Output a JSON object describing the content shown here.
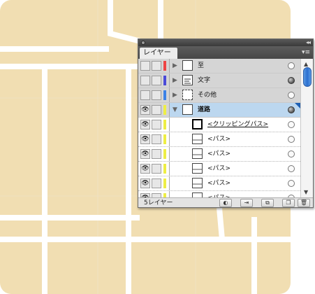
{
  "map": {
    "background_color": "#ffffff",
    "block_color": "#f1deb2",
    "road_color": "#ffffff",
    "tile_line_color": "#ece4d2"
  },
  "panel": {
    "collapse_icon": "double-chevron-left-icon",
    "tab_label": "レイヤー",
    "menu_icon": "panel-menu-icon",
    "layers": [
      {
        "name": "至",
        "kind": "main",
        "expanded": false,
        "color": "#ee4444",
        "visible": false,
        "target_filled": false,
        "thumb": "frame"
      },
      {
        "name": "文字",
        "kind": "main",
        "expanded": false,
        "color": "#4a4ad8",
        "visible": false,
        "target_filled": true,
        "thumb": "text-lines"
      },
      {
        "name": "その他",
        "kind": "main",
        "expanded": false,
        "color": "#3c82e6",
        "visible": false,
        "target_filled": false,
        "thumb": "dashed"
      },
      {
        "name": "道路",
        "kind": "main",
        "expanded": true,
        "color": "#eeee44",
        "visible": true,
        "target_filled": true,
        "selected": true,
        "thumb": "frame"
      },
      {
        "name": "<クリッピングパス>",
        "kind": "sub",
        "color": "#eeee44",
        "visible": true,
        "target_filled": false,
        "clip": true,
        "thumb": "clip"
      },
      {
        "name": "<パス>",
        "kind": "sub",
        "color": "#eeee44",
        "visible": true,
        "target_filled": false,
        "thumb": "path"
      },
      {
        "name": "<パス>",
        "kind": "sub",
        "color": "#eeee44",
        "visible": true,
        "target_filled": false,
        "thumb": "path"
      },
      {
        "name": "<パス>",
        "kind": "sub",
        "color": "#eeee44",
        "visible": true,
        "target_filled": false,
        "thumb": "path"
      },
      {
        "name": "<パス>",
        "kind": "sub",
        "color": "#eeee44",
        "visible": true,
        "target_filled": false,
        "thumb": "path"
      },
      {
        "name": "<パス>",
        "kind": "sub",
        "color": "#eeee44",
        "visible": true,
        "target_filled": false,
        "thumb": "path"
      }
    ],
    "footer": {
      "layer_count": "5レイヤー",
      "buttons": [
        {
          "name": "locate-object-button",
          "icon": "locate-object-icon",
          "glyph": "◐"
        },
        {
          "name": "make-clipping-mask-button",
          "icon": "clipping-mask-icon",
          "glyph": "⇥"
        },
        {
          "name": "new-sublayer-button",
          "icon": "new-sublayer-icon",
          "glyph": "⧉"
        },
        {
          "name": "new-layer-button",
          "icon": "new-layer-icon",
          "glyph": "❐"
        },
        {
          "name": "delete-layer-button",
          "icon": "trash-icon",
          "glyph": "🗑"
        }
      ]
    }
  }
}
